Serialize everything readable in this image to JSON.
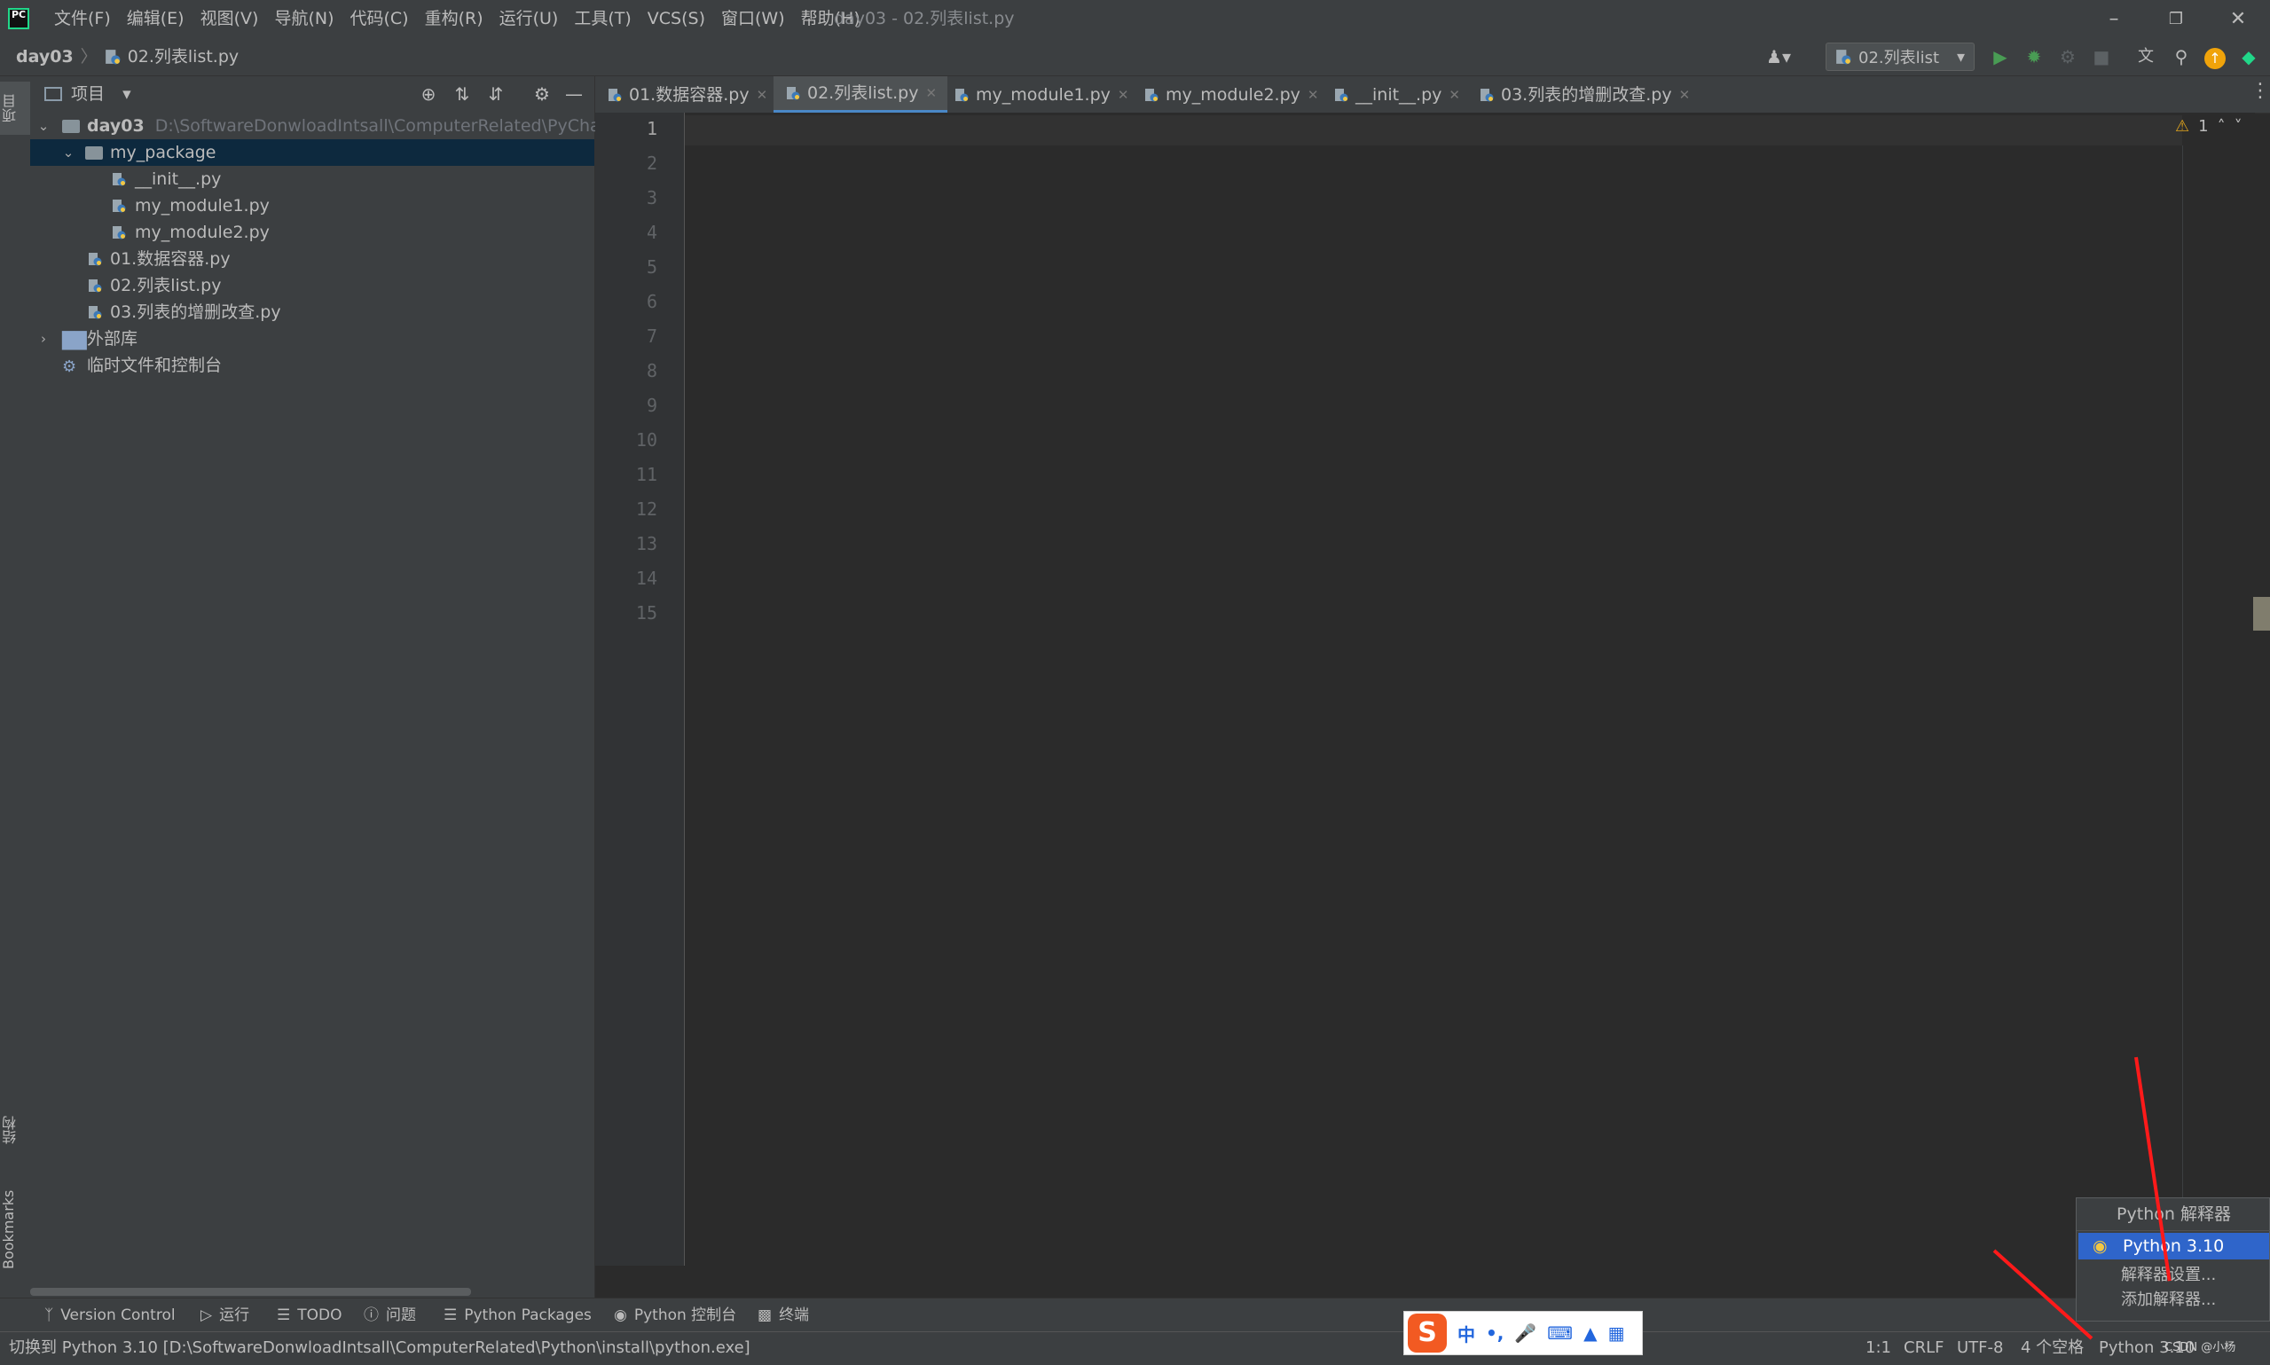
{
  "app": {
    "window_title": "day03 - 02.列表list.py",
    "logo_text": "PC"
  },
  "menu": [
    "文件(F)",
    "编辑(E)",
    "视图(V)",
    "导航(N)",
    "代码(C)",
    "重构(R)",
    "运行(U)",
    "工具(T)",
    "VCS(S)",
    "窗口(W)",
    "帮助(H)"
  ],
  "breadcrumb": {
    "project": "day03",
    "file": "02.列表list.py"
  },
  "run_config": {
    "label": "02.列表list"
  },
  "left_stripe": {
    "project_tab": "项目",
    "structure_tab": "结构",
    "bookmarks_tab": "Bookmarks"
  },
  "project_panel": {
    "title": "项目",
    "tree": {
      "root_name": "day03",
      "root_path": "D:\\SoftwareDonwloadIntsall\\ComputerRelated\\PyCharm\\he",
      "package": "my_package",
      "package_files": [
        "__init__.py",
        "my_module1.py",
        "my_module2.py"
      ],
      "files": [
        "01.数据容器.py",
        "02.列表list.py",
        "03.列表的增删改查.py"
      ],
      "external_libs": "外部库",
      "scratches": "临时文件和控制台"
    }
  },
  "editor": {
    "tabs": [
      {
        "label": "01.数据容器.py",
        "active": false
      },
      {
        "label": "02.列表list.py",
        "active": true
      },
      {
        "label": "my_module1.py",
        "active": false
      },
      {
        "label": "my_module2.py",
        "active": false
      },
      {
        "label": "__init__.py",
        "active": false
      },
      {
        "label": "03.列表的增删改查.py",
        "active": false
      }
    ],
    "line_numbers": [
      "1",
      "2",
      "3",
      "4",
      "5",
      "6",
      "7",
      "8",
      "9",
      "10",
      "11",
      "12",
      "13",
      "14",
      "15"
    ],
    "warning_count": "1"
  },
  "bottom_tools": [
    "Version Control",
    "运行",
    "TODO",
    "问题",
    "Python Packages",
    "Python 控制台",
    "终端"
  ],
  "status": {
    "message": "切换到 Python 3.10 [D:\\SoftwareDonwloadIntsall\\ComputerRelated\\Python\\install\\python.exe]",
    "position": "1:1",
    "line_sep": "CRLF",
    "encoding": "UTF-8",
    "indent": "4 个空格",
    "interpreter": "Python 3.10"
  },
  "popup": {
    "title": "Python 解释器",
    "selected": "Python 3.10",
    "items": [
      "解释器设置...",
      "添加解释器..."
    ]
  },
  "ime": {
    "logo": "S",
    "mode": "中",
    "punct": "•,"
  },
  "watermark": "CSDN @小杨"
}
